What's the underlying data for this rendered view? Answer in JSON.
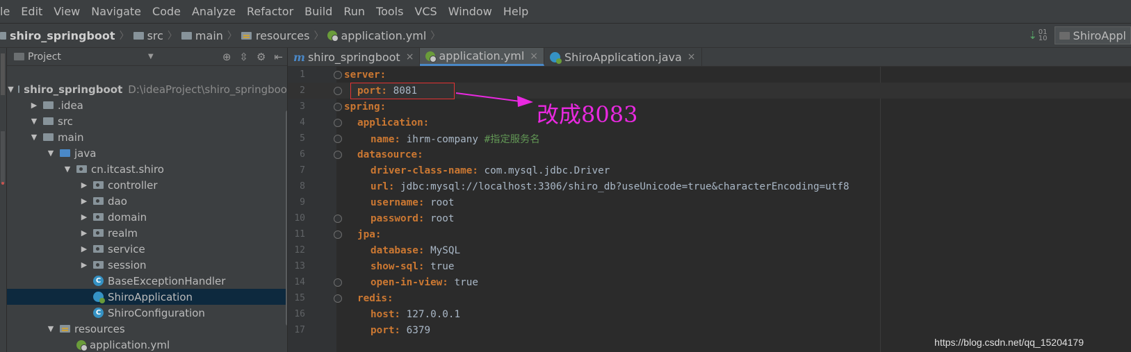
{
  "menubar": {
    "items": [
      "le",
      "Edit",
      "View",
      "Navigate",
      "Code",
      "Analyze",
      "Refactor",
      "Build",
      "Run",
      "Tools",
      "VCS",
      "Window",
      "Help"
    ]
  },
  "navbar": {
    "crumbs": [
      "shiro_springboot",
      "src",
      "main",
      "resources",
      "application.yml"
    ],
    "run_config": "ShiroAppl"
  },
  "project_panel": {
    "title": "Project",
    "tree": [
      {
        "label": "shiro_springboot",
        "path": "D:\\ideaProject\\shiro_springboo",
        "icon": "folder",
        "arrow": "▼"
      },
      {
        "label": ".idea",
        "icon": "folder",
        "arrow": "▶"
      },
      {
        "label": "src",
        "icon": "folder",
        "arrow": "▼"
      },
      {
        "label": "main",
        "icon": "folder",
        "arrow": "▼"
      },
      {
        "label": "java",
        "icon": "java-folder",
        "arrow": "▼"
      },
      {
        "label": "cn.itcast.shiro",
        "icon": "package",
        "arrow": "▼"
      },
      {
        "label": "controller",
        "icon": "package",
        "arrow": "▶"
      },
      {
        "label": "dao",
        "icon": "package",
        "arrow": "▶"
      },
      {
        "label": "domain",
        "icon": "package",
        "arrow": "▶"
      },
      {
        "label": "realm",
        "icon": "package",
        "arrow": "▶"
      },
      {
        "label": "service",
        "icon": "package",
        "arrow": "▶"
      },
      {
        "label": "session",
        "icon": "package",
        "arrow": "▶"
      },
      {
        "label": "BaseExceptionHandler",
        "icon": "class",
        "arrow": ""
      },
      {
        "label": "ShiroApplication",
        "icon": "spring-class",
        "arrow": "",
        "selected": true
      },
      {
        "label": "ShiroConfiguration",
        "icon": "class",
        "arrow": ""
      },
      {
        "label": "resources",
        "icon": "resources-folder",
        "arrow": "▼"
      },
      {
        "label": "application.yml",
        "icon": "yml",
        "arrow": ""
      }
    ]
  },
  "tabs": [
    {
      "label": "shiro_springboot",
      "icon": "m-icon",
      "active": false
    },
    {
      "label": "application.yml",
      "icon": "yml-icon",
      "active": true
    },
    {
      "label": "ShiroApplication.java",
      "icon": "spring-class-icon",
      "active": false
    }
  ],
  "editor": {
    "lines": [
      {
        "n": "1",
        "k": "server:",
        "v": "",
        "c": "",
        "indent": 0
      },
      {
        "n": "2",
        "k": "port:",
        "v": " 8081",
        "c": "",
        "indent": 1
      },
      {
        "n": "3",
        "k": "spring:",
        "v": "",
        "c": "",
        "indent": 0
      },
      {
        "n": "4",
        "k": "application:",
        "v": "",
        "c": "",
        "indent": 1
      },
      {
        "n": "5",
        "k": "name:",
        "v": " ihrm-company ",
        "c": "#指定服务名",
        "indent": 2
      },
      {
        "n": "6",
        "k": "datasource:",
        "v": "",
        "c": "",
        "indent": 1
      },
      {
        "n": "7",
        "k": "driver-class-name:",
        "v": " com.mysql.jdbc.Driver",
        "c": "",
        "indent": 2
      },
      {
        "n": "8",
        "k": "url:",
        "v": " jdbc:mysql://localhost:3306/shiro_db?useUnicode=true&characterEncoding=utf8",
        "c": "",
        "indent": 2
      },
      {
        "n": "9",
        "k": "username:",
        "v": " root",
        "c": "",
        "indent": 2
      },
      {
        "n": "10",
        "k": "password:",
        "v": " root",
        "c": "",
        "indent": 2
      },
      {
        "n": "11",
        "k": "jpa:",
        "v": "",
        "c": "",
        "indent": 1
      },
      {
        "n": "12",
        "k": "database:",
        "v": " MySQL",
        "c": "",
        "indent": 2
      },
      {
        "n": "13",
        "k": "show-sql:",
        "v": " true",
        "c": "",
        "indent": 2
      },
      {
        "n": "14",
        "k": "open-in-view:",
        "v": " true",
        "c": "",
        "indent": 2
      },
      {
        "n": "15",
        "k": "redis:",
        "v": "",
        "c": "",
        "indent": 1
      },
      {
        "n": "16",
        "k": "host:",
        "v": " 127.0.0.1",
        "c": "",
        "indent": 2
      },
      {
        "n": "17",
        "k": "port:",
        "v": " 6379",
        "c": "",
        "indent": 2
      }
    ]
  },
  "annotation": {
    "text": "改成8083",
    "color": "#e929e0"
  },
  "watermark": "https://blog.csdn.net/qq_15204179",
  "colors": {
    "key": "#cc7832",
    "value": "#a9b7c6",
    "comment": "#629755",
    "selection": "#0d293e",
    "accent": "#4a88c7",
    "annotation": "#e929e0",
    "highlight_box": "#e53333"
  }
}
